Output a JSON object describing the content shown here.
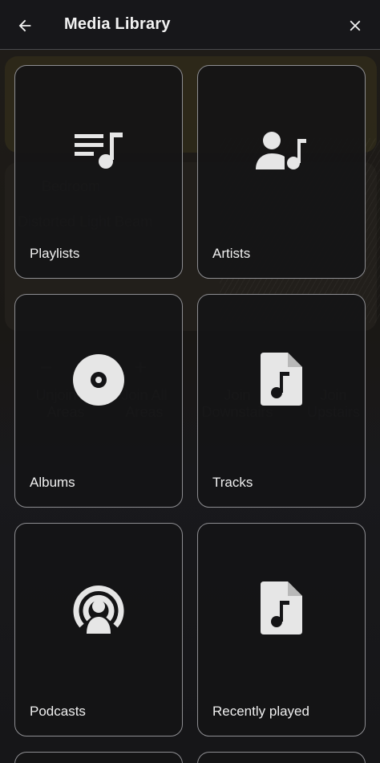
{
  "header": {
    "title": "Media Library",
    "back_icon": "arrow-left-icon",
    "close_icon": "close-icon"
  },
  "background": {
    "room_name": "Bedroom",
    "track": "Distorted Light Beam",
    "unjoin_all": "Unjoin All Areas",
    "join_all": "Join All Areas",
    "join_downstairs": "Join Downstairs",
    "join_upstairs": "Join Upstairs"
  },
  "tiles": [
    {
      "label": "Playlists",
      "icon": "playlist-music-icon"
    },
    {
      "label": "Artists",
      "icon": "account-music-icon"
    },
    {
      "label": "Albums",
      "icon": "album-disc-icon"
    },
    {
      "label": "Tracks",
      "icon": "music-file-icon"
    },
    {
      "label": "Podcasts",
      "icon": "podcast-icon"
    },
    {
      "label": "Recently played",
      "icon": "music-file-icon"
    }
  ],
  "colors": {
    "background": "#16161a",
    "tile_border": "#8e8e92",
    "icon": "#e6e6e6"
  }
}
